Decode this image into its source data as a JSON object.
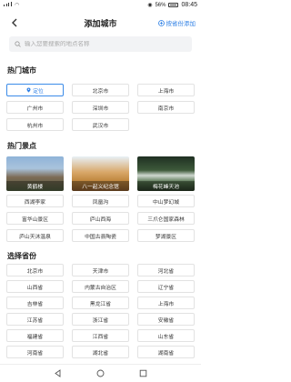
{
  "status": {
    "time": "08:45",
    "battery": "56%"
  },
  "header": {
    "title": "添加城市",
    "right_label": "按省份添加"
  },
  "search": {
    "placeholder": "输入您要搜索的地点名称"
  },
  "hot_cities": {
    "title": "热门城市",
    "items": [
      "定位",
      "北京市",
      "上海市",
      "广州市",
      "深圳市",
      "南京市",
      "杭州市",
      "武汉市"
    ]
  },
  "hot_spots": {
    "title": "热门景点",
    "photos": [
      "黄鹤楼",
      "八一起义纪念馆",
      "梅花峰天池"
    ],
    "items": [
      "西湖李家",
      "凤凰沟",
      "中山梦幻城",
      "富华山景区",
      "庐山西海",
      "三爪仑国家森林",
      "庐山天沐温泉",
      "中国古县陶瓷",
      "梦湖景区"
    ]
  },
  "provinces": {
    "title": "选择省份",
    "items": [
      "北京市",
      "天津市",
      "河北省",
      "山西省",
      "内蒙古自治区",
      "辽宁省",
      "吉林省",
      "黑龙江省",
      "上海市",
      "江苏省",
      "浙江省",
      "安徽省",
      "福建省",
      "江西省",
      "山东省",
      "河南省",
      "湖北省",
      "湖南省"
    ]
  },
  "colors": {
    "accent": "#2d7fe5"
  }
}
